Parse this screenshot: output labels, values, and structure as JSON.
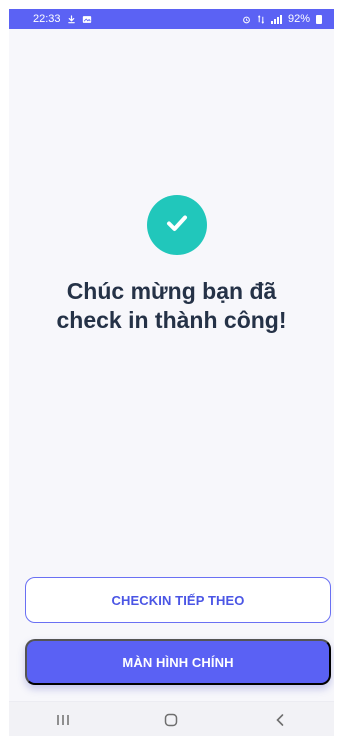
{
  "status_bar": {
    "time": "22:33",
    "battery_text": "92%"
  },
  "content": {
    "line1": "Chúc mừng bạn đã",
    "line2": "check in thành công!"
  },
  "buttons": {
    "checkin_next": "CHECKIN TIẾP THEO",
    "main_screen": "MÀN HÌNH CHÍNH"
  },
  "icons": {
    "status_left": [
      "download-icon",
      "image-icon"
    ],
    "status_right": [
      "alarm-icon",
      "network-icon",
      "signal-icon",
      "battery-icon"
    ],
    "success": "check-icon",
    "nav": [
      "recent-apps-icon",
      "home-icon",
      "back-icon"
    ]
  },
  "colors": {
    "accent": "#5b62f4",
    "success": "#21c7bb",
    "text": "#253247"
  }
}
